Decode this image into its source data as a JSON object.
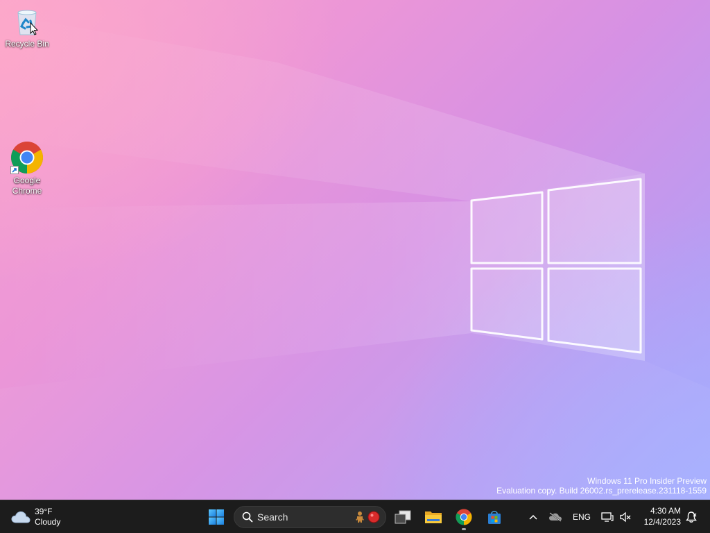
{
  "desktop": {
    "icons": [
      {
        "label": "Recycle Bin",
        "icon": "recycle-bin-icon"
      },
      {
        "label": "Google Chrome",
        "icon": "chrome-icon"
      }
    ],
    "watermark": {
      "line1": "Windows 11 Pro Insider Preview",
      "line2": "Evaluation copy. Build 26002.rs_prerelease.231118-1559"
    },
    "wallpaper_colors": [
      "#f7a3cf",
      "#d691e4",
      "#a6a8fb"
    ]
  },
  "taskbar": {
    "weather": {
      "temperature": "39°F",
      "condition": "Cloudy",
      "icon": "cloud-icon"
    },
    "start_icon": "windows-start-icon",
    "search": {
      "placeholder": "Search",
      "icon": "search-icon"
    },
    "pinned": [
      {
        "name": "Task View",
        "icon": "task-view-icon"
      },
      {
        "name": "File Explorer",
        "icon": "file-explorer-icon"
      },
      {
        "name": "Google Chrome",
        "icon": "chrome-icon",
        "active": true
      },
      {
        "name": "Microsoft Store",
        "icon": "store-icon"
      }
    ],
    "tray": {
      "language": "ENG",
      "time": "4:30 AM",
      "date": "12/4/2023"
    },
    "accent_color": "#0078d4",
    "background_color": "#1c1c1c"
  }
}
